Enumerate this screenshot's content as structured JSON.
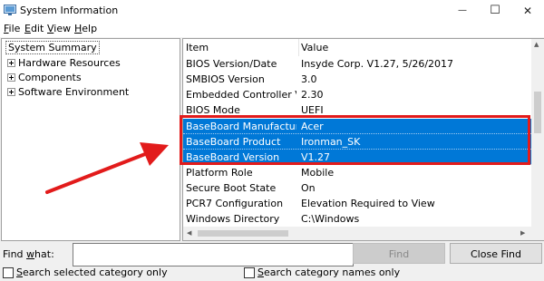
{
  "window": {
    "title": "System Information",
    "minimize_glyph": "—",
    "maximize_glyph": "☐",
    "close_glyph": "✕"
  },
  "menu": {
    "file": {
      "mnemonic": "F",
      "rest": "ile"
    },
    "edit": {
      "mnemonic": "E",
      "rest": "dit"
    },
    "view": {
      "mnemonic": "V",
      "rest": "iew"
    },
    "help": {
      "mnemonic": "H",
      "rest": "elp"
    }
  },
  "tree": {
    "root": "System Summary",
    "items": [
      {
        "label": "Hardware Resources"
      },
      {
        "label": "Components"
      },
      {
        "label": "Software Environment"
      }
    ]
  },
  "table": {
    "headers": {
      "item": "Item",
      "value": "Value"
    },
    "rows": [
      {
        "item": "BIOS Version/Date",
        "value": "Insyde Corp. V1.27, 5/26/2017"
      },
      {
        "item": "SMBIOS Version",
        "value": "3.0"
      },
      {
        "item": "Embedded Controller V...",
        "value": "2.30"
      },
      {
        "item": "BIOS Mode",
        "value": "UEFI"
      },
      {
        "item": "BaseBoard Manufacturer",
        "value": "Acer"
      },
      {
        "item": "BaseBoard Product",
        "value": "Ironman_SK"
      },
      {
        "item": "BaseBoard Version",
        "value": "V1.27"
      },
      {
        "item": "Platform Role",
        "value": "Mobile"
      },
      {
        "item": "Secure Boot State",
        "value": "On"
      },
      {
        "item": "PCR7 Configuration",
        "value": "Elevation Required to View"
      },
      {
        "item": "Windows Directory",
        "value": "C:\\Windows"
      }
    ]
  },
  "find": {
    "label_mnemonic_prefix": "Find ",
    "label_mnemonic": "w",
    "label_rest": "hat:",
    "value": "",
    "find_button": "Find",
    "close_find_button": "Close Find",
    "search_selected_prefix": "",
    "search_selected_mnemonic": "S",
    "search_selected_rest": "earch selected category only",
    "search_names_mnemonic": "S",
    "search_names_rest": "earch category names only"
  },
  "colors": {
    "selection": "#0078d7",
    "annotation": "#e21b1b"
  }
}
